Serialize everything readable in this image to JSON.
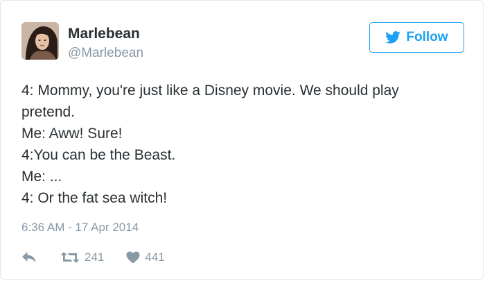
{
  "user": {
    "name": "Marlebean",
    "handle": "@Marlebean"
  },
  "follow_button": {
    "label": "Follow",
    "icon": "twitter-bird-icon"
  },
  "tweet": {
    "lines": [
      "4: Mommy, you're just like a Disney movie. We should play",
      "pretend.",
      "Me: Aww! Sure!",
      "4:You can be the Beast.",
      "Me: ...",
      "4: Or the fat sea witch!"
    ],
    "timestamp": "6:36 AM - 17 Apr 2014"
  },
  "actions": {
    "reply_icon": "reply-icon",
    "retweet_icon": "retweet-icon",
    "retweet_count": "241",
    "like_icon": "heart-icon",
    "like_count": "441"
  },
  "colors": {
    "accent": "#1da1f2",
    "text": "#292f33",
    "muted": "#8899a6",
    "border": "#e1e8ed"
  }
}
